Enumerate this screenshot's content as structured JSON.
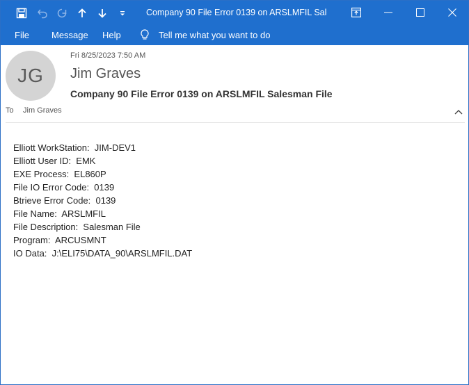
{
  "window": {
    "title": "Company 90 File Error 0139 on ARSLMFIL Sales...",
    "accent_color": "#1f6fce"
  },
  "menu": {
    "file": "File",
    "message": "Message",
    "help": "Help",
    "tell_me": "Tell me what you want to do"
  },
  "header": {
    "avatar_initials": "JG",
    "date": "Fri 8/25/2023 7:50 AM",
    "sender": "Jim Graves",
    "subject": "Company 90 File Error 0139 on ARSLMFIL Salesman File",
    "to_label": "To",
    "to_name": "Jim Graves"
  },
  "body": {
    "lines": [
      "Elliott WorkStation:  JIM-DEV1",
      "Elliott User ID:  EMK",
      "EXE Process:  EL860P",
      "File IO Error Code:  0139",
      "Btrieve Error Code:  0139",
      "File Name:  ARSLMFIL",
      "File Description:  Salesman File",
      "Program:  ARCUSMNT",
      "IO Data:  J:\\ELI75\\DATA_90\\ARSLMFIL.DAT"
    ]
  }
}
